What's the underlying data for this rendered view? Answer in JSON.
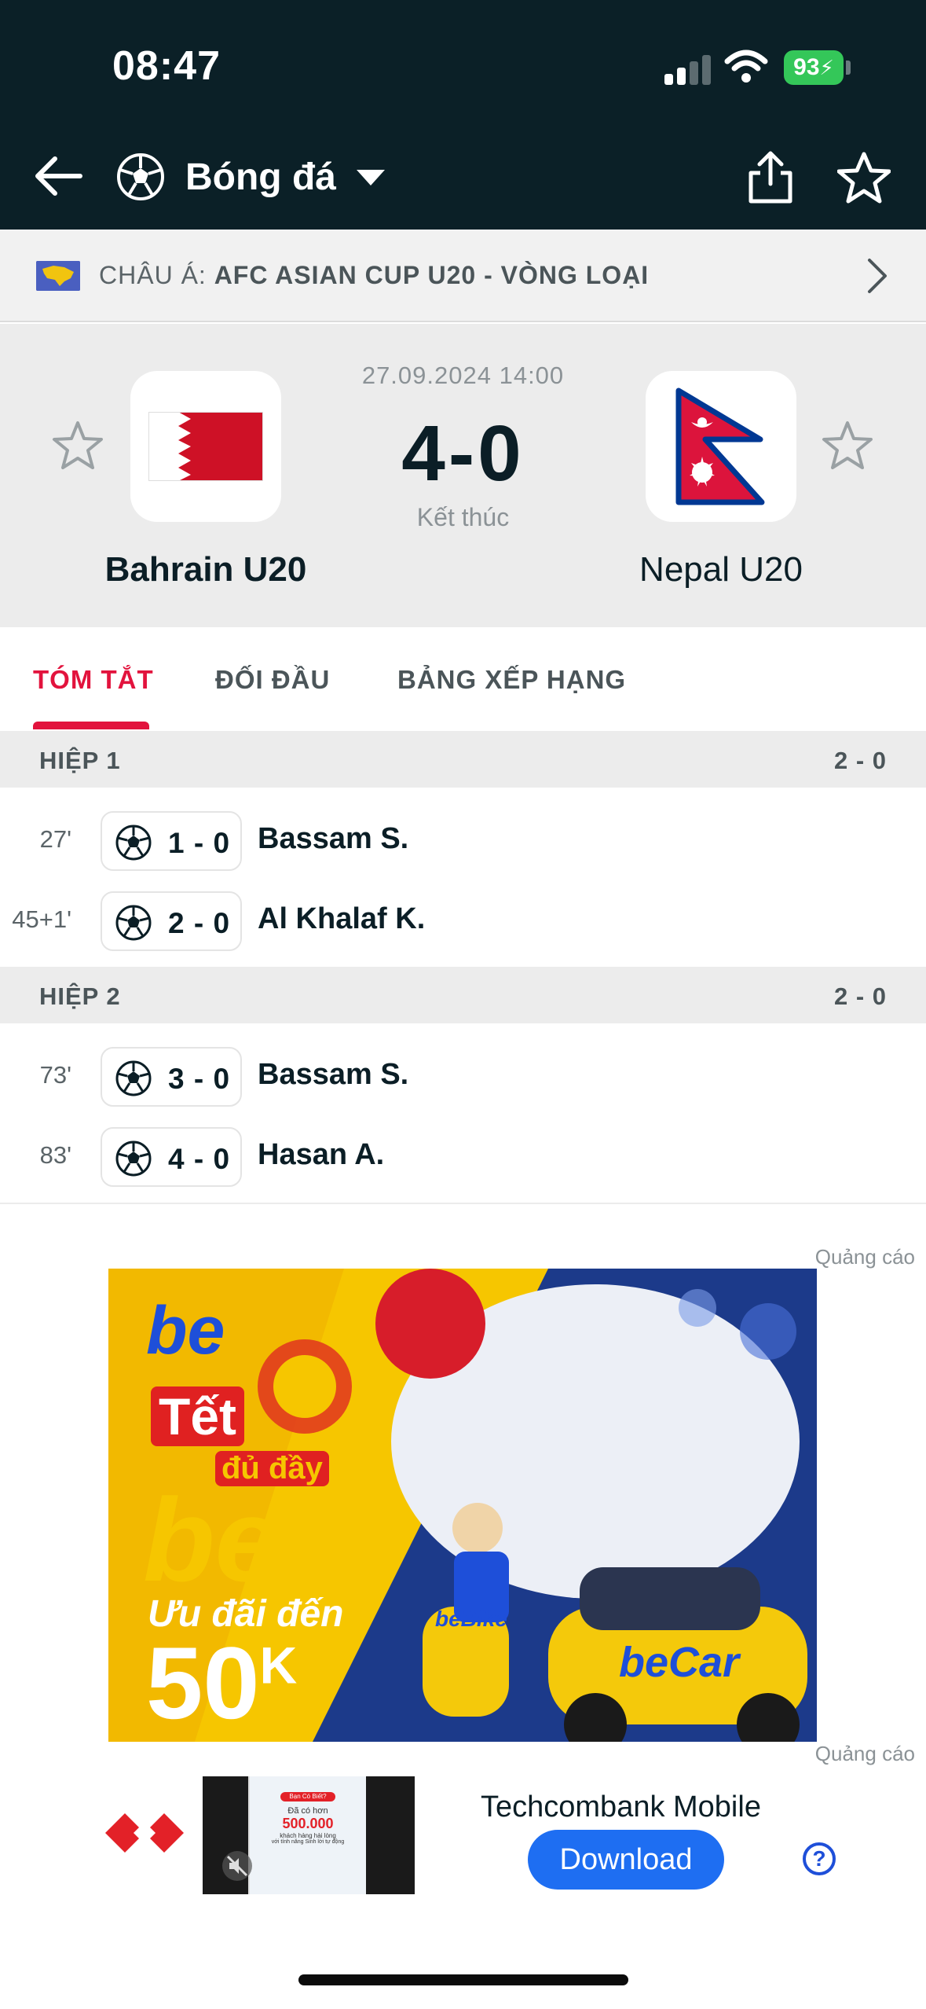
{
  "status_bar": {
    "time": "08:47",
    "battery": "93"
  },
  "header": {
    "title": "Bóng đá"
  },
  "competition": {
    "region_label": "CHÂU Á:",
    "name": "AFC ASIAN CUP U20 - VÒNG LOẠI"
  },
  "match": {
    "datetime": "27.09.2024 14:00",
    "score": "4-0",
    "status": "Kết thúc",
    "home_team": "Bahrain U20",
    "away_team": "Nepal U20"
  },
  "tabs": [
    {
      "label": "TÓM TẮT",
      "active": true
    },
    {
      "label": "ĐỐI ĐẦU",
      "active": false
    },
    {
      "label": "BẢNG XẾP HẠNG",
      "active": false
    }
  ],
  "halves": [
    {
      "label": "HIỆP 1",
      "score": "2 - 0",
      "events": [
        {
          "minute": "27'",
          "score": "1 - 0",
          "player": "Bassam S."
        },
        {
          "minute": "45+1'",
          "score": "2 - 0",
          "player": "Al Khalaf K."
        }
      ]
    },
    {
      "label": "HIỆP 2",
      "score": "2 - 0",
      "events": [
        {
          "minute": "73'",
          "score": "3 - 0",
          "player": "Bassam S."
        },
        {
          "minute": "83'",
          "score": "4 - 0",
          "player": "Hasan A."
        }
      ]
    }
  ],
  "ads": {
    "label": "Quảng cáo",
    "banner": {
      "brand": "be",
      "line1": "Tết",
      "line2": "đủ đầy",
      "brand2": "be",
      "line3": "Ưu đãi đến",
      "amount": "50",
      "unit": "K",
      "vehicle1": "beBike",
      "vehicle2": "beCar"
    },
    "app_ad": {
      "title": "Techcombank Mobile",
      "cta": "Download",
      "thumb_tag": "Bạn Có Biết?",
      "thumb_line1": "Đã có hơn",
      "thumb_number": "500.000",
      "thumb_line2": "khách hàng hài lòng",
      "thumb_line3": "với tính năng Sinh lời tự động",
      "help": "?"
    }
  },
  "colors": {
    "header_bg": "#0b2027",
    "accent": "#e2133d",
    "download": "#1e6ef2"
  }
}
